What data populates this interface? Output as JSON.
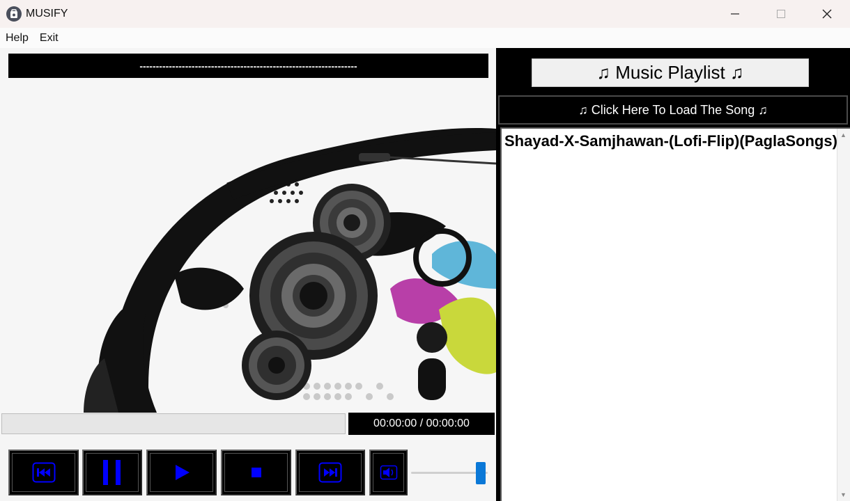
{
  "window": {
    "title": "MUSIFY",
    "minimize_icon": "minimize-icon",
    "maximize_icon": "maximize-icon",
    "close_icon": "close-icon"
  },
  "menu": {
    "items": [
      "Help",
      "Exit"
    ]
  },
  "player": {
    "song_name": "-------------------------------------------------------------------",
    "time_display": "00:00:00 / 00:00:00",
    "progress": 0,
    "volume": 0.9,
    "accent_color": "#0000ff",
    "controls": [
      {
        "name": "previous-button",
        "icon": "previous-icon"
      },
      {
        "name": "pause-button",
        "icon": "pause-icon"
      },
      {
        "name": "play-button",
        "icon": "play-icon"
      },
      {
        "name": "stop-button",
        "icon": "stop-icon"
      },
      {
        "name": "next-button",
        "icon": "next-icon"
      },
      {
        "name": "mute-button",
        "icon": "speaker-icon"
      }
    ]
  },
  "playlist": {
    "title": "♫ Music Playlist ♫",
    "load_button": "♫ Click Here To Load The Song ♫",
    "songs": [
      "Shayad-X-Samjhawan-(Lofi-Flip)(PaglaSongs)"
    ]
  }
}
